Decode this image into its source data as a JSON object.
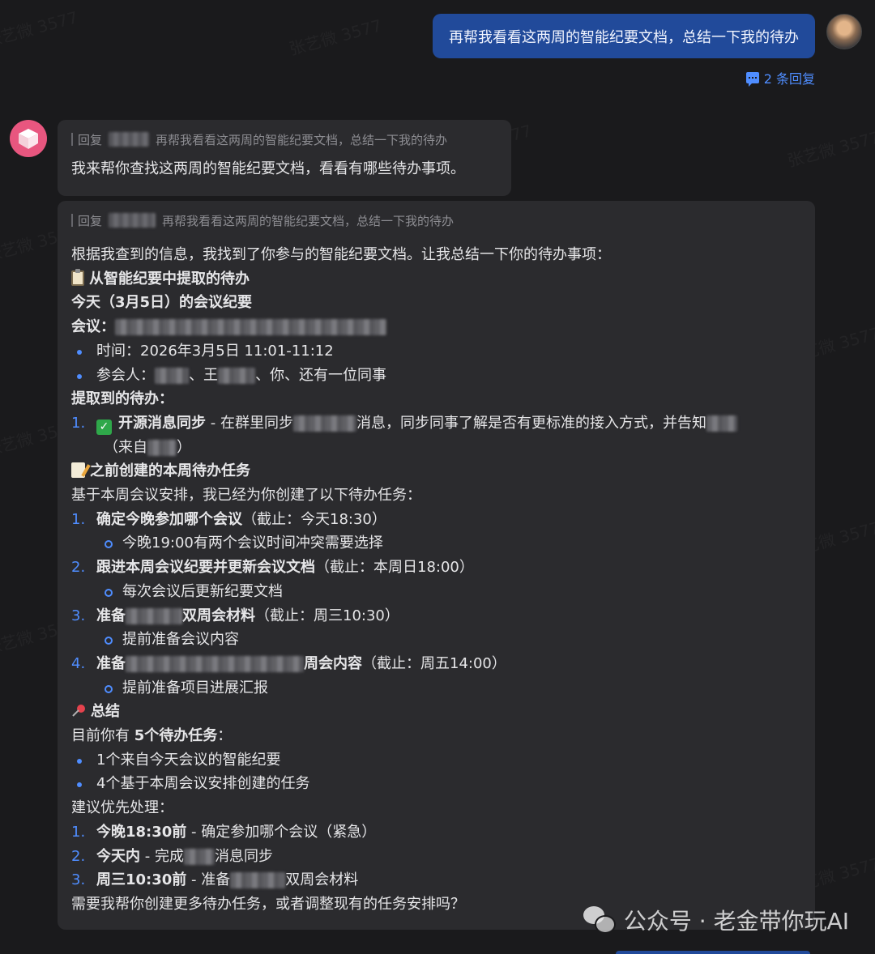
{
  "watermark": "张艺微 3577",
  "user_message": "再帮我看看这两周的智能纪要文档，总结一下我的待办",
  "reply_link": "2 条回复",
  "quote": {
    "prefix": "回复",
    "text": "再帮我看看这两周的智能纪要文档，总结一下我的待办"
  },
  "bubble1": {
    "text": "我来帮你查找这两周的智能纪要文档，看看有哪些待办事项。"
  },
  "bubble2": {
    "intro": "根据我查到的信息，我找到了你参与的智能纪要文档。让我总结一下你的待办事项：",
    "section1_title": "从智能纪要中提取的待办",
    "today_title": "今天（3月5日）的会议纪要",
    "meeting_label": "会议：",
    "time": "时间：2026年3月5日 11:01-11:12",
    "attendees_a": "参会人：",
    "attendees_b": "、王",
    "attendees_c": "、你、还有一位同事",
    "extracted_title": "提取到的待办：",
    "ext1_num": "1.",
    "ext1_bold": "开源消息同步",
    "ext1_a": " - 在群里同步",
    "ext1_b": "消息，同步同事了解是否有更标准的接入方式，并告知",
    "ext1_cont_a": "（来自",
    "ext1_cont_b": "）",
    "section2_title": "之前创建的本周待办任务",
    "section2_intro": "基于本周会议安排，我已经为你创建了以下待办任务：",
    "tasks": [
      {
        "num": "1.",
        "bold": "确定今晚参加哪个会议",
        "rest": "（截止：今天18:30）",
        "sub": "今晚19:00有两个会议时间冲突需要选择"
      },
      {
        "num": "2.",
        "bold": "跟进本周会议纪要并更新会议文档",
        "rest": "（截止：本周日18:00）",
        "sub": "每次会议后更新纪要文档"
      },
      {
        "num": "3.",
        "bold_a": "准备",
        "bold_b": "双周会材料",
        "rest": "（截止：周三10:30）",
        "sub": "提前准备会议内容"
      },
      {
        "num": "4.",
        "bold_a": "准备",
        "bold_b": "周会内容",
        "rest": "（截止：周五14:00）",
        "sub": "提前准备项目进展汇报"
      }
    ],
    "summary_title": "总结",
    "summary_a": "目前你有 ",
    "summary_b": "5个待办任务",
    "summary_c": "：",
    "summary_items": [
      "1个来自今天会议的智能纪要",
      "4个基于本周会议安排创建的任务"
    ],
    "priority_title": "建议优先处理：",
    "priority": [
      {
        "num": "1.",
        "bold": "今晚18:30前",
        "rest": " - 确定参加哪个会议（紧急）"
      },
      {
        "num": "2.",
        "bold": "今天内",
        "rest_a": " - 完成",
        "rest_b": "消息同步"
      },
      {
        "num": "3.",
        "bold": "周三10:30前",
        "rest_a": " - 准备",
        "rest_b": "双周会材料"
      }
    ],
    "closing": "需要我帮你创建更多待办任务，或者调整现有的任务安排吗？"
  },
  "brand": "公众号 · 老金带你玩AI",
  "colors": {
    "accent": "#4f8dff",
    "user_bubble": "#214a9a",
    "bot_bubble": "#2b2b2e",
    "bot_avatar": "#e8567f"
  }
}
